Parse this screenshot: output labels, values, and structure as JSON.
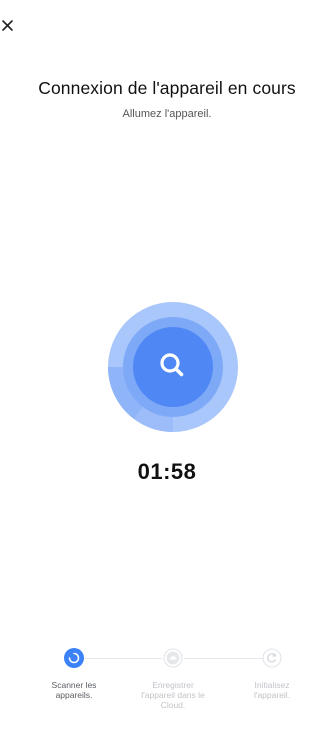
{
  "header": {
    "title": "Connexion de l'appareil en cours",
    "subtitle": "Allumez l'appareil."
  },
  "icons": {
    "close": "close-icon",
    "search": "search-icon",
    "step_active": "spinner-icon",
    "step_cloud": "cloud-icon",
    "step_init": "refresh-icon"
  },
  "scanner": {
    "timer": "01:58"
  },
  "steps": [
    {
      "label": "Scanner les appareils.",
      "state": "active"
    },
    {
      "label": "Enregistrer l'appareil dans le Cloud.",
      "state": "pending"
    },
    {
      "label": "Initialisez l'appareil.",
      "state": "pending"
    }
  ],
  "colors": {
    "accent": "#3b82f6",
    "ring_light": "#a9c7fb",
    "ring_mid": "#7aa6f7",
    "core": "#4f87f5",
    "inactive": "#c0c3c8"
  }
}
